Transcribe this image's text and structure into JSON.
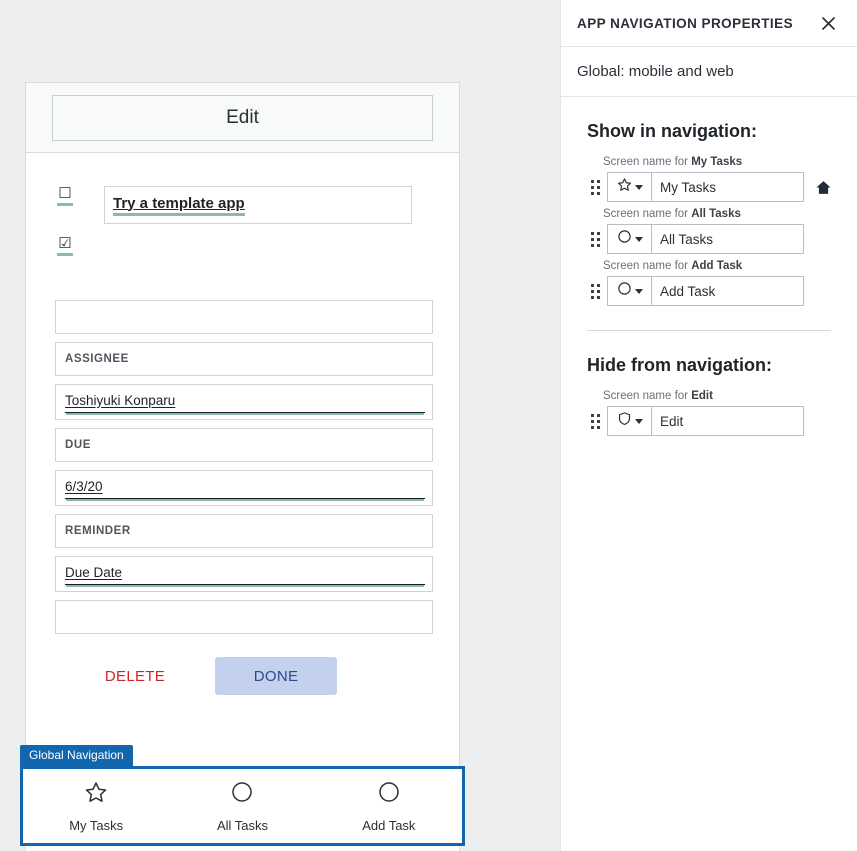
{
  "panel": {
    "title": "APP NAVIGATION PROPERTIES",
    "close_icon": "close-icon",
    "subtitle": "Global: mobile and web",
    "show_section": {
      "heading": "Show in navigation:",
      "items": [
        {
          "caption_prefix": "Screen name for ",
          "screen": "My Tasks",
          "icon": "star-icon",
          "value": "My Tasks",
          "home_marker": true
        },
        {
          "caption_prefix": "Screen name for ",
          "screen": "All Tasks",
          "icon": "circle-icon",
          "value": "All Tasks",
          "home_marker": false
        },
        {
          "caption_prefix": "Screen name for ",
          "screen": "Add Task",
          "icon": "circle-icon",
          "value": "Add Task",
          "home_marker": false
        }
      ]
    },
    "hide_section": {
      "heading": "Hide from navigation:",
      "items": [
        {
          "caption_prefix": "Screen name for ",
          "screen": "Edit",
          "icon": "shield-icon",
          "value": "Edit",
          "home_marker": false
        }
      ]
    }
  },
  "app_preview": {
    "header_title": "Edit",
    "task": {
      "checkbox_unchecked_icon": "checkbox-unchecked-icon",
      "checkbox_checked_icon": "checkbox-checked-icon",
      "title": "Try a template app"
    },
    "fields": [
      {
        "type": "empty"
      },
      {
        "type": "label",
        "label": "ASSIGNEE"
      },
      {
        "type": "value",
        "value": "Toshiyuki Konparu"
      },
      {
        "type": "label",
        "label": "DUE"
      },
      {
        "type": "value",
        "value": "6/3/20"
      },
      {
        "type": "label",
        "label": "REMINDER"
      },
      {
        "type": "value",
        "value": "Due Date"
      },
      {
        "type": "empty"
      }
    ],
    "buttons": {
      "delete_label": "DELETE",
      "done_label": "DONE"
    },
    "global_nav": {
      "tag": "Global Navigation",
      "items": [
        {
          "icon": "star-icon",
          "label": "My Tasks"
        },
        {
          "icon": "circle-icon",
          "label": "All Tasks"
        },
        {
          "icon": "circle-icon",
          "label": "Add Task"
        }
      ]
    }
  },
  "colors": {
    "accent_blue": "#1266ae",
    "done_button_bg": "#c3d0ee",
    "done_button_text": "#2b4a8b",
    "delete_text": "#c62828",
    "field_underline_teal": "#8cb8b4"
  }
}
